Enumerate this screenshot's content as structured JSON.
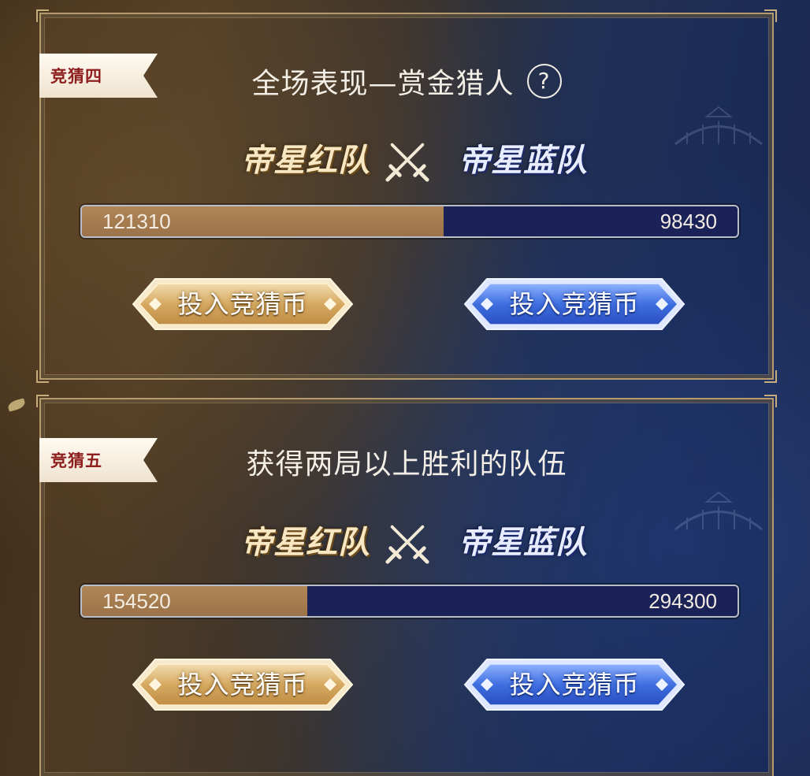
{
  "colors": {
    "red_team_accent": "#b08656",
    "blue_team_accent": "#1b2257",
    "tag_text": "#8e1d1d",
    "border_gold": "#b49a6c"
  },
  "bets": [
    {
      "tag": "竞猜四",
      "title": "全场表现—赏金猎人",
      "help_icon": "?",
      "team_red": "帝星红队",
      "team_blue": "帝星蓝队",
      "red_amount": "121310",
      "blue_amount": "98430",
      "red_share": 0.552,
      "btn_red_label": "投入竞猜币",
      "btn_blue_label": "投入竞猜币"
    },
    {
      "tag": "竞猜五",
      "title": "获得两局以上胜利的队伍",
      "team_red": "帝星红队",
      "team_blue": "帝星蓝队",
      "red_amount": "154520",
      "blue_amount": "294300",
      "red_share": 0.344,
      "btn_red_label": "投入竞猜币",
      "btn_blue_label": "投入竞猜币"
    }
  ]
}
